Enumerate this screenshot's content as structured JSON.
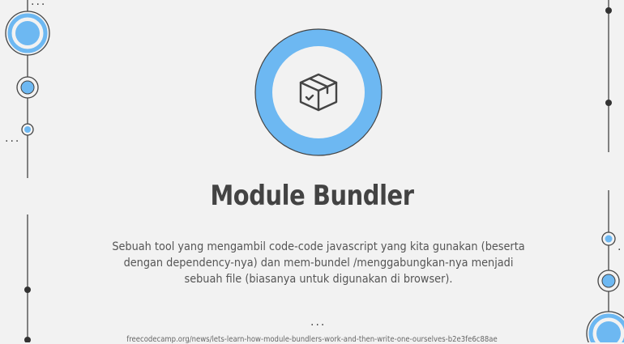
{
  "slide": {
    "title": "Module Bundler",
    "description": "Sebuah tool yang mengambil code-code javascript yang kita gunakan (beserta dengan dependency-nya) dan mem-bundel /menggabungkan-nya menjadi sebuah file (biasanya untuk digunakan di browser).",
    "ellipsis": "...",
    "source_link": "freecodecamp.org/news/lets-learn-how-module-bundlers-work-and-then-write-one-ourselves-b2e3fe6c88ae"
  },
  "icon": {
    "name": "package-box-icon"
  },
  "colors": {
    "background": "#f2f2f2",
    "accent_blue": "#6db8f2",
    "text_dark": "#434343",
    "line_gray": "#444444"
  }
}
